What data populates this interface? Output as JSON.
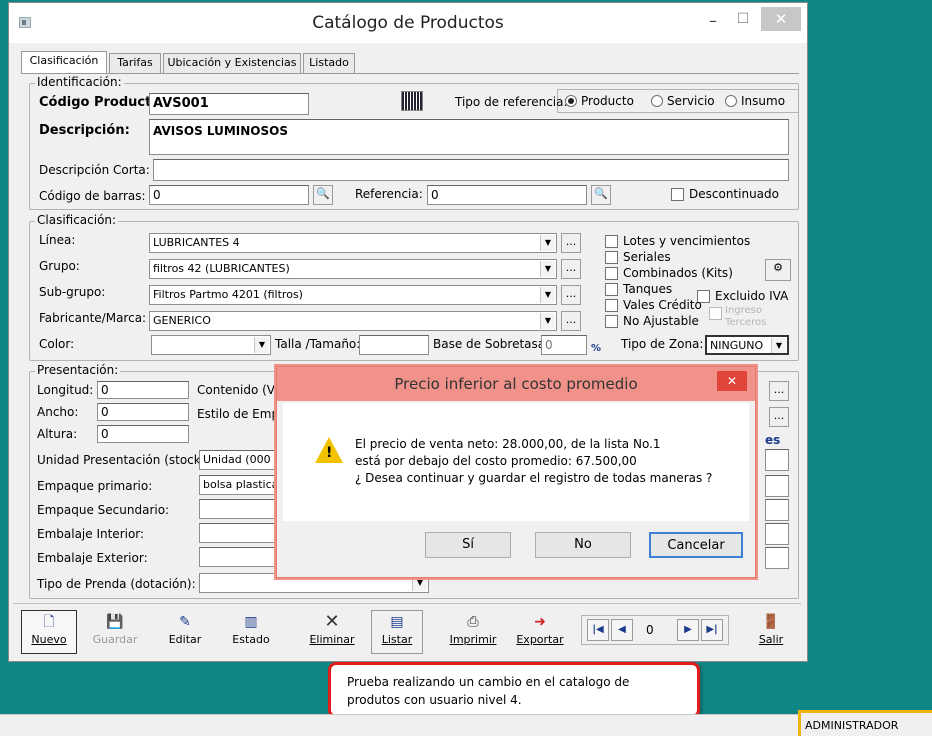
{
  "window": {
    "title": "Catálogo de Productos",
    "close": "✕",
    "minimize": "–",
    "maximize": "☐"
  },
  "tabs": [
    "Clasificación",
    "Tarifas",
    "Ubicación y Existencias",
    "Listado"
  ],
  "ident": {
    "legend": "Identificación:",
    "codigo_label": "Código Producto:",
    "codigo_value": "AVS001",
    "tipo_ref_label": "Tipo de referencia:",
    "radio_producto": "Producto",
    "radio_servicio": "Servicio",
    "radio_insumo": "Insumo",
    "descripcion_label": "Descripción:",
    "descripcion_value": "AVISOS LUMINOSOS",
    "desc_corta_label": "Descripción Corta:",
    "desc_corta_value": "",
    "barras_label": "Código de barras:",
    "barras_value": "0",
    "referencia_label": "Referencia:",
    "referencia_value": "0",
    "descontinuado": "Descontinuado"
  },
  "clasif": {
    "legend": "Clasificación:",
    "linea_label": "Línea:",
    "linea_value": "LUBRICANTES 4",
    "grupo_label": "Grupo:",
    "grupo_value": "filtros 42 (LUBRICANTES)",
    "subgrupo_label": "Sub-grupo:",
    "subgrupo_value": "Filtros Partmo 4201 (filtros)",
    "fabricante_label": "Fabricante/Marca:",
    "fabricante_value": "GENERICO",
    "color_label": "Color:",
    "talla_label": "Talla /Tamaño:",
    "base_label": "Base de Sobretasa:",
    "base_value": "0",
    "pct": "%",
    "lotes": "Lotes y vencimientos",
    "seriales": "Seriales",
    "combinados": "Combinados (Kits)",
    "tanques": "Tanques",
    "excluido": "Excluido IVA",
    "vales": "Vales Crédito",
    "ingreso": "Ingreso",
    "terceros": "Terceros",
    "no_ajustable": "No Ajustable",
    "tipo_zona_label": "Tipo de Zona:",
    "tipo_zona_value": "NINGUNO",
    "dots": "..."
  },
  "present": {
    "legend": "Presentación:",
    "longitud_label": "Longitud:",
    "longitud_value": "0",
    "ancho_label": "Ancho:",
    "ancho_value": "0",
    "altura_label": "Altura:",
    "altura_value": "0",
    "contenido_label": "Contenido (Vo",
    "estilo_label": "Estilo de Empa",
    "unidad_label": "Unidad Presentación (stock):",
    "unidad_value": "Unidad (000",
    "emp_primario_label": "Empaque primario:",
    "emp_primario_value": "bolsa plastica",
    "emp_secundario_label": "Empaque Secundario:",
    "emb_interior_label": "Embalaje Interior:",
    "emb_exterior_label": "Embalaje Exterior:",
    "tipo_prenda_label": "Tipo de Prenda (dotación):",
    "es_link": "es"
  },
  "toolbar": {
    "nuevo": "Nuevo",
    "guardar": "Guardar",
    "editar": "Editar",
    "estado": "Estado",
    "eliminar": "Eliminar",
    "listar": "Listar",
    "imprimir": "Imprimir",
    "exportar": "Exportar",
    "nav_value": "0",
    "salir": "Salir"
  },
  "dialog": {
    "title": "Precio inferior al costo promedio",
    "line1": "El precio de venta neto: 28.000,00, de la lista No.1",
    "line2": "está por debajo del costo promedio: 67.500,00",
    "line3": "¿ Desea continuar y guardar el registro de todas maneras ?",
    "si": "Sí",
    "no": "No",
    "cancelar": "Cancelar",
    "close": "✕"
  },
  "callout": {
    "text1": "Prueba realizando un cambio en el catalogo de",
    "text2": "produtos con usuario nivel 4."
  },
  "status": {
    "user": "ADMINISTRADOR"
  }
}
